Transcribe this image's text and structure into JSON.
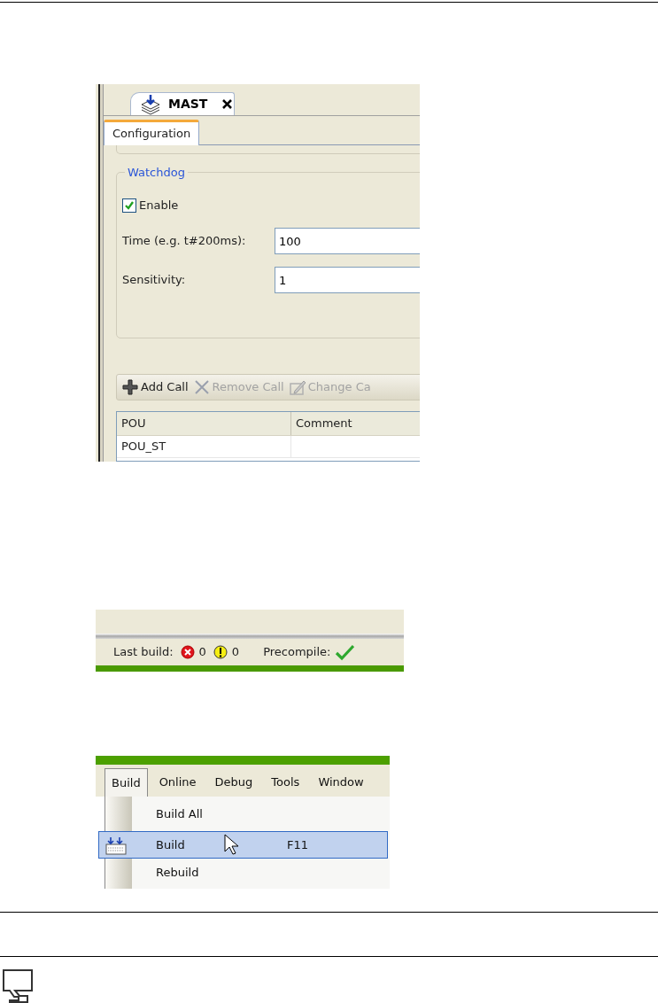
{
  "editor": {
    "tab": {
      "label": "MAST"
    },
    "subtabs": [
      {
        "label": "Configuration",
        "selected": true
      }
    ],
    "watchdog": {
      "title": "Watchdog",
      "enable": {
        "label": "Enable",
        "checked": true
      },
      "fields": [
        {
          "label": "Time (e.g. t#200ms):",
          "value": "100"
        },
        {
          "label": "Sensitivity:",
          "value": "1"
        }
      ]
    },
    "toolbar": [
      {
        "kind": "add",
        "label": "Add Call",
        "disabled": false
      },
      {
        "kind": "remove",
        "label": "Remove Call",
        "disabled": true
      },
      {
        "kind": "edit",
        "label": "Change Ca",
        "disabled": true
      }
    ],
    "table": {
      "columns": [
        "POU",
        "Comment"
      ],
      "rows": [
        {
          "pou": "POU_ST"
        }
      ]
    }
  },
  "status_bar": {
    "label": "Last build:",
    "errors": "0",
    "warnings": "0",
    "precompile_label": "Precompile:",
    "precompile_ok": true
  },
  "menu": {
    "items": [
      {
        "label": "Build",
        "selected": true
      },
      {
        "label": "Online",
        "selected": false
      },
      {
        "label": "Debug",
        "selected": false
      },
      {
        "label": "Tools",
        "selected": false
      },
      {
        "label": "Window",
        "selected": false
      }
    ],
    "dropdown": [
      {
        "label": "Build All",
        "selected": false
      },
      {
        "label": "Build",
        "shortcut": "F11",
        "selected": true,
        "icon": true
      },
      {
        "label": "Rebuild",
        "selected": false
      }
    ]
  }
}
